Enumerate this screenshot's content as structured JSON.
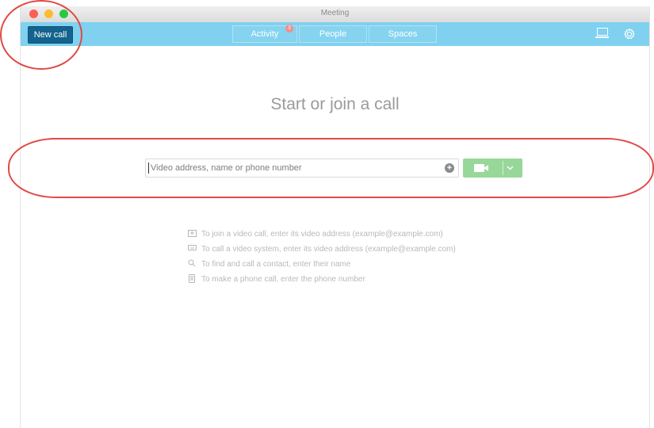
{
  "window": {
    "title": "Meeting"
  },
  "toolbar": {
    "new_call_label": "New call",
    "tabs": [
      {
        "label": "Activity",
        "badge": "3"
      },
      {
        "label": "People"
      },
      {
        "label": "Spaces"
      }
    ],
    "icons": [
      "laptop-icon",
      "gear-icon"
    ]
  },
  "main": {
    "heading": "Start or join a call",
    "search": {
      "value": "",
      "placeholder": "Video address, name or phone number"
    },
    "call_button": {
      "icon": "video-camera-icon",
      "dropdown_icon": "chevron-down-icon"
    },
    "hints": [
      {
        "icon": "video-address-icon",
        "text": "To join a video call, enter its video address (example@example.com)"
      },
      {
        "icon": "video-system-icon",
        "text": "To call a video system, enter its video address (example@example.com)"
      },
      {
        "icon": "search-icon",
        "text": "To find and call a contact, enter their name"
      },
      {
        "icon": "phone-icon",
        "text": "To make a phone call, enter the phone number"
      }
    ]
  },
  "colors": {
    "toolbar": "#7fd1ef",
    "new_call": "#13638e",
    "call_button": "#97d79a",
    "annotation": "#e04a44"
  }
}
